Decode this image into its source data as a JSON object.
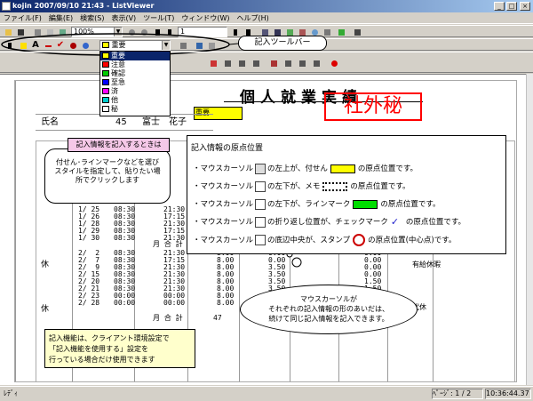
{
  "window": {
    "title": "kojin 2007/09/10 21:43 - ListViewer",
    "min": "_",
    "max": "□",
    "close": "×"
  },
  "menu": [
    "ファイル(F)",
    "編集(E)",
    "検索(S)",
    "表示(V)",
    "ツール(T)",
    "ウィンドウ(W)",
    "ヘルプ(H)"
  ],
  "toolbar": {
    "zoom": "100%",
    "page": "1"
  },
  "memo_tool": {
    "selected": "重要",
    "options": [
      "重要",
      "注意",
      "確認",
      "至急",
      "済",
      "他",
      "秘"
    ],
    "option_colors": [
      "#ffff00",
      "#ff0000",
      "#00cc00",
      "#0000ff",
      "#ff00ff",
      "#00cccc",
      "#ffffff"
    ]
  },
  "document": {
    "title": "個人就業実績",
    "name_label": "氏名",
    "name_code": "45",
    "name_value": "富士　花子",
    "memo_tag": "重要",
    "stamp": "社外秘",
    "rest_label_1": "休",
    "rest_label_2": "休",
    "rows_1": "1/ 25\n1/ 26\n1/ 28\n1/ 29\n1/ 30",
    "start_1": "08:30\n08:30\n08:30\n08:30\n08:30",
    "end_1": "21:30\n17:15\n21:30\n17:15\n21:30",
    "monthly_label": "月 合 計",
    "rows_2": "2/  2\n2/  7\n2/  9\n2/ 15\n2/ 20\n2/ 21\n2/ 23\n2/ 28",
    "start_2": "08:30\n08:30\n08:30\n08:30\n08:30\n08:30\n00:00\n00:00",
    "end_2": "21:30\n17:15\n21:30\n21:30\n21:30\n21:30\n00:00\n00:00",
    "hours_2": "8.00\n8.00\n8.00\n8.00\n8.00\n8.00\n8.00\n8.00",
    "ot_2": "0.00\n0.00\n3.50\n3.50\n3.50\n3.50",
    "ex_2": "0.00\n0.00\n0.00\n0.00\n1.50\n1.50",
    "monthly_total_label": "月 合 計",
    "monthly_total_value": "47",
    "note_paid": "有給休暇",
    "note_sub": "代休"
  },
  "callouts": {
    "toolbar_label": "記入ツールバー",
    "howto_title": "記入情報を記入するときは",
    "howto_body": "付せん･ラインマークなどを選び\nスタイルを指定して、貼りたい場\n所でクリックします",
    "origin_title": "記入情報の原点位置",
    "origin_lines": [
      "・マウスカーソル",
      "・マウスカーソル",
      "・マウスカーソル",
      "・マウスカーソル",
      "・マウスカーソル"
    ],
    "origin_mid": [
      "の左上が、付せん",
      "の左下が、メモ",
      "の左下が、ラインマーク",
      "の折り返し位置が、チェックマーク",
      "の底辺中央が、スタンプ"
    ],
    "origin_end": [
      "の原点位置です。",
      "の原点位置です。",
      "の原点位置です。",
      "の原点位置です。",
      "の原点位置(中心点)です。"
    ],
    "sticky_mini": "重要",
    "thought": "マウスカーソルが\nそれぞれの記入情報の形のあいだは、\n続けて同じ記入情報を記入できます。",
    "note": "記入機能は、クライアント環境設定で\n「記入機能を使用する」設定を\n行っている場合だけ使用できます"
  },
  "status": {
    "left": "ﾚﾃﾞｨ",
    "page": "ﾍﾟｰｼﾞ: 1 / 2",
    "time": "10:36:44.37"
  }
}
